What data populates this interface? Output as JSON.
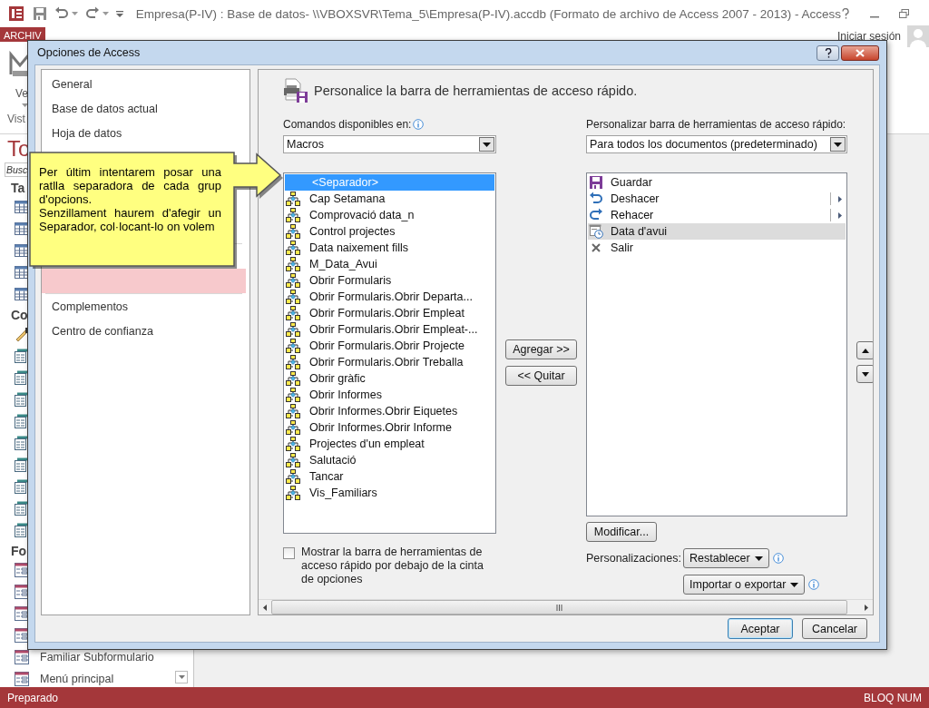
{
  "app": {
    "title": "Empresa(P-IV) : Base de datos- \\\\VBOXSVR\\Tema_5\\Empresa(P-IV).accdb (Formato de archivo de Access 2007 - 2013) - Access",
    "file_tab": "ARCHIV",
    "sign_in": "Iniciar sesión",
    "ribbon": {
      "view_label": "Ve",
      "group_label": "Vist"
    },
    "nav_pane": {
      "title": "To",
      "search_placeholder": "Busc",
      "items": [
        {
          "kind": "group",
          "label": "Ta"
        },
        {
          "kind": "table"
        },
        {
          "kind": "table"
        },
        {
          "kind": "table"
        },
        {
          "kind": "table"
        },
        {
          "kind": "table"
        },
        {
          "kind": "group",
          "label": "Co"
        },
        {
          "kind": "query-design"
        },
        {
          "kind": "query"
        },
        {
          "kind": "query"
        },
        {
          "kind": "query"
        },
        {
          "kind": "query"
        },
        {
          "kind": "query"
        },
        {
          "kind": "query"
        },
        {
          "kind": "query"
        },
        {
          "kind": "query"
        },
        {
          "kind": "query"
        },
        {
          "kind": "group",
          "label": "Fo"
        },
        {
          "kind": "form"
        },
        {
          "kind": "form"
        },
        {
          "kind": "form"
        },
        {
          "kind": "form"
        },
        {
          "kind": "form",
          "label": "Familiar Subformulario"
        },
        {
          "kind": "form",
          "label": "Menú principal"
        }
      ]
    },
    "status_bar": {
      "left": "Preparado",
      "right": "BLOQ NUM"
    }
  },
  "dialog": {
    "title": "Opciones de Access",
    "nav": [
      {
        "kind": "item",
        "label": "General",
        "selected": false
      },
      {
        "kind": "item",
        "label": "Base de datos actual",
        "selected": false
      },
      {
        "kind": "item",
        "label": "Hoja de datos",
        "selected": false
      },
      {
        "kind": "item",
        "selected": false
      },
      {
        "kind": "item",
        "selected": false
      },
      {
        "kind": "item",
        "selected": false
      },
      {
        "kind": "item",
        "selected": false
      },
      {
        "kind": "separator"
      },
      {
        "kind": "item",
        "selected": false
      },
      {
        "kind": "item",
        "selected": true
      },
      {
        "kind": "separator"
      },
      {
        "kind": "item",
        "label": "Complementos",
        "selected": false
      },
      {
        "kind": "item",
        "label": "Centro de confianza",
        "selected": false
      }
    ],
    "heading": "Personalice la barra de herramientas de acceso rápido.",
    "commands_label": "Comandos disponibles en:",
    "commands_source": "Macros",
    "commands": [
      {
        "kind": "separator",
        "label": "<Separador>",
        "selected": true
      },
      {
        "kind": "macro",
        "label": "Cap Setamana",
        "selected": false
      },
      {
        "kind": "macro",
        "label": "Comprovació data_n",
        "selected": false
      },
      {
        "kind": "macro",
        "label": "Control projectes",
        "selected": false
      },
      {
        "kind": "macro",
        "label": "Data naixement fills",
        "selected": false
      },
      {
        "kind": "macro",
        "label": "M_Data_Avui",
        "selected": false
      },
      {
        "kind": "macro",
        "label": "Obrir Formularis",
        "selected": false
      },
      {
        "kind": "macro",
        "label": "Obrir Formularis.Obrir Departa...",
        "selected": false
      },
      {
        "kind": "macro",
        "label": "Obrir Formularis.Obrir Empleat",
        "selected": false
      },
      {
        "kind": "macro",
        "label": "Obrir Formularis.Obrir Empleat-...",
        "selected": false
      },
      {
        "kind": "macro",
        "label": "Obrir Formularis.Obrir Projecte",
        "selected": false
      },
      {
        "kind": "macro",
        "label": "Obrir Formularis.Obrir Treballa",
        "selected": false
      },
      {
        "kind": "macro",
        "label": "Obrir gràfic",
        "selected": false
      },
      {
        "kind": "macro",
        "label": "Obrir Informes",
        "selected": false
      },
      {
        "kind": "macro",
        "label": "Obrir Informes.Obrir Eiquetes",
        "selected": false
      },
      {
        "kind": "macro",
        "label": "Obrir Informes.Obrir Informe",
        "selected": false
      },
      {
        "kind": "macro",
        "label": "Projectes d'un empleat",
        "selected": false
      },
      {
        "kind": "macro",
        "label": "Salutació",
        "selected": false
      },
      {
        "kind": "macro",
        "label": "Tancar",
        "selected": false
      },
      {
        "kind": "macro",
        "label": "Vis_Familiars",
        "selected": false
      }
    ],
    "add_button": "Agregar >>",
    "remove_button": "<< Quitar",
    "toolbar_label": "Personalizar barra de herramientas de acceso rápido:",
    "toolbar_scope": "Para todos los documentos (predeterminado)",
    "toolbar_items": [
      {
        "kind": "save",
        "label": "Guardar",
        "submenu": false,
        "selected": false
      },
      {
        "kind": "undo",
        "label": "Deshacer",
        "submenu": true,
        "selected": false
      },
      {
        "kind": "redo",
        "label": "Rehacer",
        "submenu": true,
        "selected": false
      },
      {
        "kind": "date",
        "label": "Data d'avui",
        "submenu": false,
        "selected": true
      },
      {
        "kind": "close",
        "label": "Salir",
        "submenu": false,
        "selected": false
      }
    ],
    "modify_button": "Modificar...",
    "customizations_label": "Personalizaciones:",
    "reset_button": "Restablecer",
    "import_export_button": "Importar o exportar",
    "show_below": {
      "label": "Mostrar la barra de herramientas de acceso rápido por debajo de la cinta de opciones",
      "checked": false
    },
    "ok_button": "Aceptar",
    "cancel_button": "Cancelar"
  },
  "callout": {
    "paragraphs": [
      "Per últim intentarem posar una ratlla separadora de cada grup d'opcions.",
      "Senzillament haurem d'afegir un Separador, col·locant-lo on volem"
    ]
  }
}
